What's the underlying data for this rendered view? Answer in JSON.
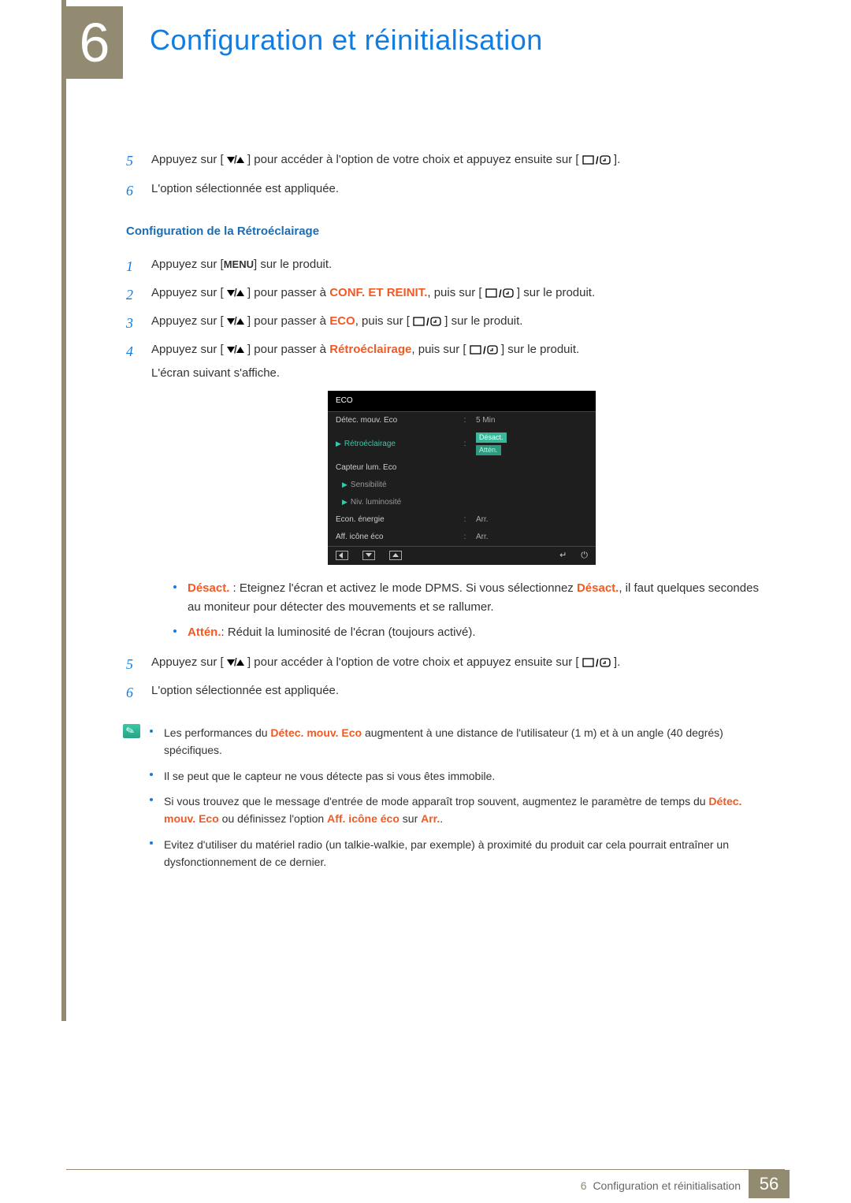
{
  "header": {
    "chapter_number": "6",
    "chapter_title": "Configuration et réinitialisation"
  },
  "top_list": {
    "item5": {
      "num": "5",
      "t1": "Appuyez sur [",
      "t2": "] pour accéder à l'option de votre choix et appuyez ensuite sur [",
      "t3": "]."
    },
    "item6": {
      "num": "6",
      "text": "L'option sélectionnée est appliquée."
    }
  },
  "subheading": "Configuration de la Rétroéclairage",
  "section2": {
    "s1": {
      "num": "1",
      "a": "Appuyez sur [",
      "menu": "MENU",
      "b": "] sur le produit."
    },
    "s2": {
      "num": "2",
      "a": "Appuyez sur [",
      "b": "] pour passer à ",
      "kw": "CONF. ET REINIT.",
      "c": ", puis sur [",
      "d": "] sur le produit."
    },
    "s3": {
      "num": "3",
      "a": "Appuyez sur [",
      "b": "] pour passer à ",
      "kw": "ECO",
      "c": ", puis sur [",
      "d": "] sur le produit."
    },
    "s4": {
      "num": "4",
      "a": "Appuyez sur [",
      "b": "] pour passer à ",
      "kw": "Rétroéclairage",
      "c": ", puis sur [",
      "d": "] sur le produit.",
      "e": "L'écran suivant s'affiche."
    }
  },
  "osd": {
    "title": "ECO",
    "rows": {
      "r1": {
        "label": "Détec. mouv. Eco",
        "value": "5 Min"
      },
      "r2": {
        "label": "Rétroéclairage",
        "v1": "Désact.",
        "v2": "Attén."
      },
      "r3": {
        "label": "Capteur lum. Eco",
        "value": ""
      },
      "r4": {
        "label": "Sensibilité",
        "value": ""
      },
      "r5": {
        "label": "Niv. luminosité",
        "value": ""
      },
      "r6": {
        "label": "Econ. énergie",
        "value": "Arr."
      },
      "r7": {
        "label": "Aff. icône éco",
        "value": "Arr."
      }
    }
  },
  "opts": {
    "b1": {
      "kw": "Désact.",
      "t1": " : Eteignez l'écran et activez le mode DPMS. Si vous sélectionnez ",
      "kw2": "Désact.",
      "t2": ", il faut quelques secondes au moniteur pour détecter des mouvements et se rallumer."
    },
    "b2": {
      "kw": "Attén.",
      "t1": ": Réduit la luminosité de l'écran (toujours activé)."
    }
  },
  "bottom_list": {
    "item5": {
      "num": "5",
      "t1": "Appuyez sur [",
      "t2": "] pour accéder à l'option de votre choix et appuyez ensuite sur [",
      "t3": "]."
    },
    "item6": {
      "num": "6",
      "text": "L'option sélectionnée est appliquée."
    }
  },
  "notes": {
    "n1": {
      "a": "Les performances du ",
      "kw": "Détec. mouv. Eco",
      "b": " augmentent à une distance de l'utilisateur (1 m) et à un angle (40 degrés) spécifiques."
    },
    "n2": "Il se peut que le capteur ne vous détecte pas si vous êtes immobile.",
    "n3": {
      "a": "Si vous trouvez que le message d'entrée de mode apparaît trop souvent, augmentez le paramètre de temps du ",
      "kw1": "Détec. mouv. Eco",
      "b": " ou définissez l'option ",
      "kw2": "Aff. icône éco",
      "c": " sur ",
      "kw3": "Arr.",
      "d": "."
    },
    "n4": "Evitez d'utiliser du matériel radio (un talkie-walkie, par exemple) à proximité du produit car cela pourrait entraîner un dysfonctionnement de ce dernier."
  },
  "footer": {
    "chapter_ref": "6",
    "title": "Configuration et réinitialisation",
    "page_number": "56"
  }
}
